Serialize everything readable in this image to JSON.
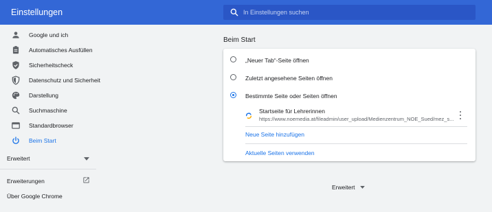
{
  "header": {
    "title": "Einstellungen",
    "search_placeholder": "In Einstellungen suchen"
  },
  "sidebar": {
    "items": [
      {
        "label": "Google und ich",
        "icon": "person-icon"
      },
      {
        "label": "Automatisches Ausfüllen",
        "icon": "clipboard-icon"
      },
      {
        "label": "Sicherheitscheck",
        "icon": "shield-check-icon"
      },
      {
        "label": "Datenschutz und Sicherheit",
        "icon": "shield-icon"
      },
      {
        "label": "Darstellung",
        "icon": "palette-icon"
      },
      {
        "label": "Suchmaschine",
        "icon": "search-icon"
      },
      {
        "label": "Standardbrowser",
        "icon": "browser-icon"
      },
      {
        "label": "Beim Start",
        "icon": "power-icon",
        "active": true
      }
    ],
    "advanced_label": "Erweitert",
    "extensions_label": "Erweiterungen",
    "about_label": "Über Google Chrome"
  },
  "main": {
    "section_title": "Beim Start",
    "options": [
      {
        "label": "„Neuer Tab“-Seite öffnen",
        "selected": false
      },
      {
        "label": "Zuletzt angesehene Seiten öffnen",
        "selected": false
      },
      {
        "label": "Bestimmte Seite oder Seiten öffnen",
        "selected": true
      }
    ],
    "page_entry": {
      "title": "Startseite für Lehrerinnen",
      "url": "https://www.noemedia.at/fileadmin/user_upload/Medienzentrum_NOE_Sued/mez_s..."
    },
    "add_page_link": "Neue Seite hinzufügen",
    "use_current_link": "Aktuelle Seiten verwenden",
    "advanced_footer": "Erweitert"
  },
  "colors": {
    "header_bg": "#3367d6",
    "search_bg": "#2a56c6",
    "accent": "#1a73e8",
    "page_bg": "#f1f3f4",
    "icon": "#5f6368"
  }
}
